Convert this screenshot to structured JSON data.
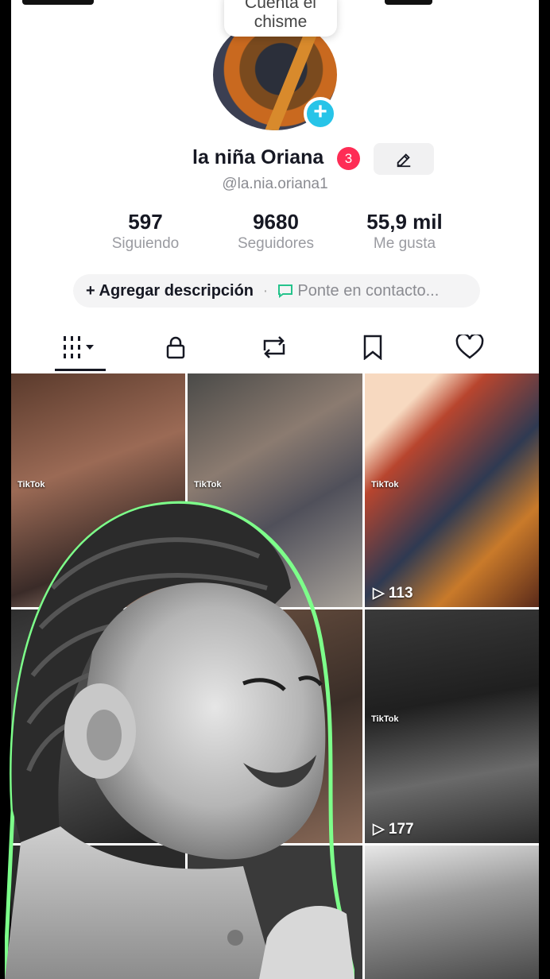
{
  "profile": {
    "bubble_text": "Cuenta el chisme",
    "display_name": "la niña Oriana",
    "notification_count": "3",
    "edit_icon": "pencil-icon",
    "username": "@la.nia.oriana1"
  },
  "stats": [
    {
      "value": "597",
      "label": "Siguiendo"
    },
    {
      "value": "9680",
      "label": "Seguidores"
    },
    {
      "value": "55,9 mil",
      "label": "Me gusta"
    }
  ],
  "description": {
    "add_label": "Agregar descripción",
    "separator": "·",
    "contact_label": "Ponte en contacto..."
  },
  "tabs": [
    {
      "icon": "grid-icon"
    },
    {
      "icon": "lock-icon"
    },
    {
      "icon": "repost-icon"
    },
    {
      "icon": "bookmark-icon"
    },
    {
      "icon": "heart-icon"
    }
  ],
  "videos": [
    {
      "views": ""
    },
    {
      "views": ""
    },
    {
      "views": "113"
    },
    {
      "views": ""
    },
    {
      "views": ""
    },
    {
      "views": "177"
    },
    {
      "views": ""
    },
    {
      "views": ""
    },
    {
      "views": ""
    }
  ],
  "watermark": "TikTok",
  "colors": {
    "accent_cyan": "#27c4e8",
    "badge_red": "#fe2c55",
    "contact_green": "#25c38c"
  }
}
